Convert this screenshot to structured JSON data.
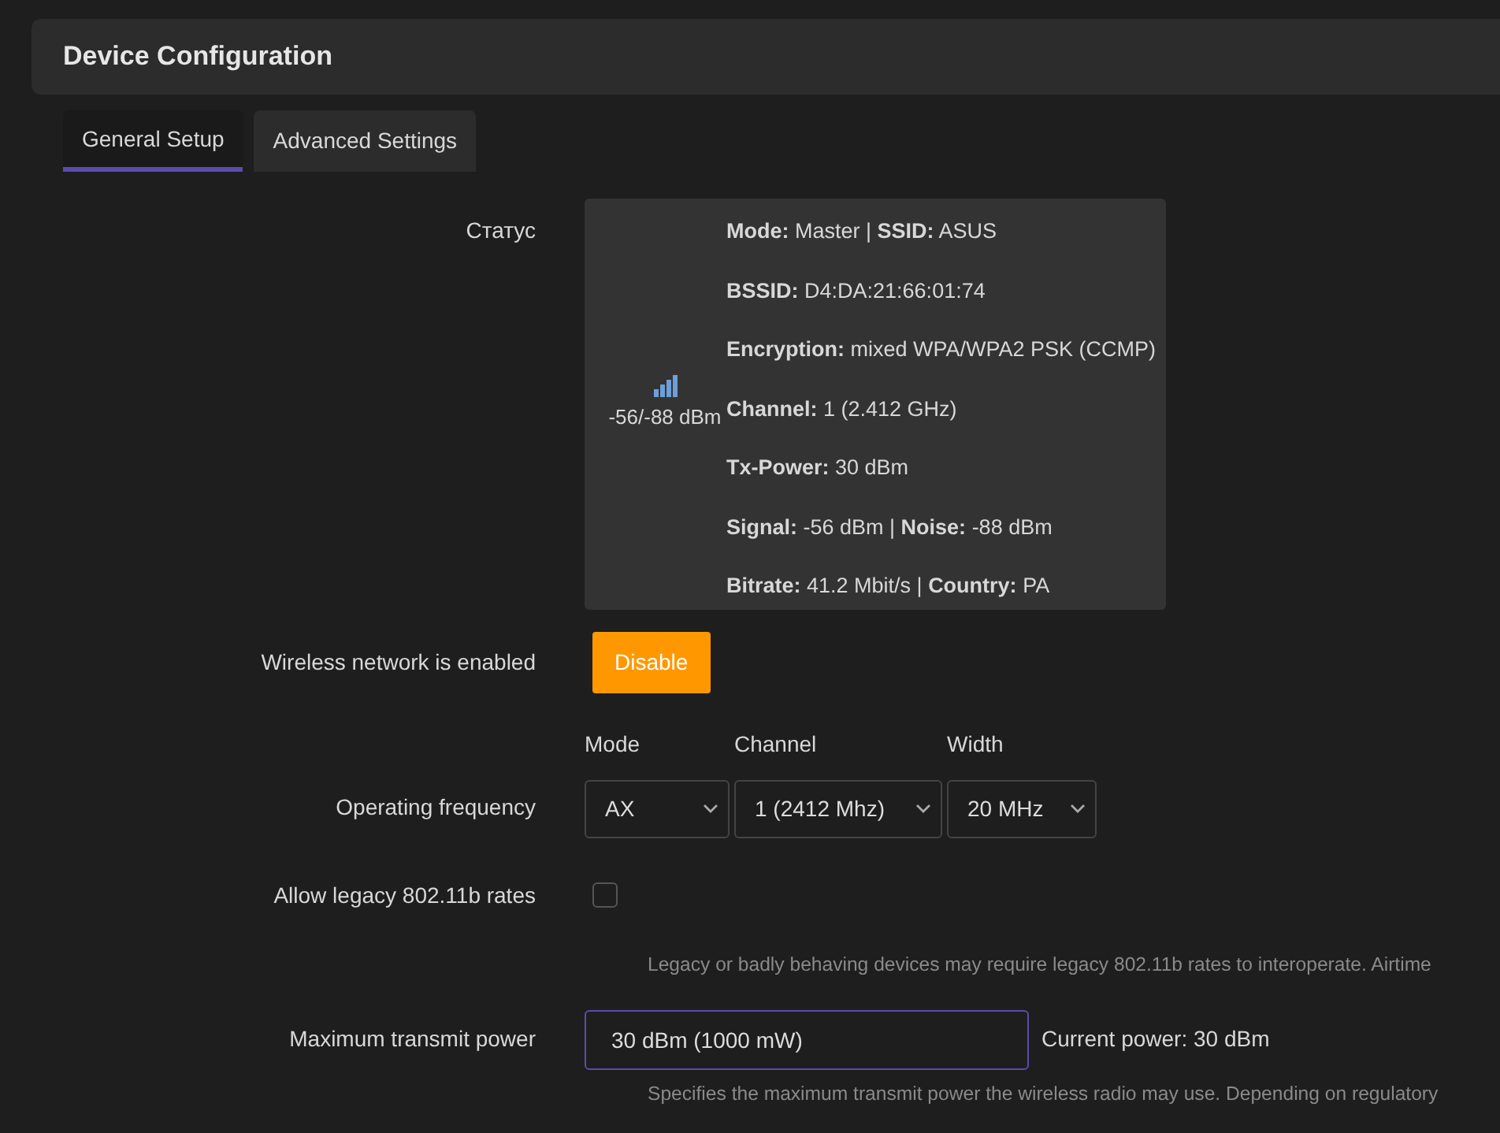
{
  "header": {
    "title": "Device Configuration"
  },
  "tabs": [
    {
      "label": "General Setup",
      "selected": true
    },
    {
      "label": "Advanced Settings",
      "selected": false
    }
  ],
  "status": {
    "label": "Статус",
    "signal_reading": "-56/-88 dBm",
    "lines": [
      "**Mode:** Master | **SSID:** ASUS",
      "**BSSID:** D4:DA:21:66:01:74",
      "**Encryption:** mixed WPA/WPA2 PSK (CCMP)",
      "**Channel:** 1 (2.412 GHz)",
      "**Tx-Power:** 30 dBm",
      "**Signal:** -56 dBm | **Noise:** -88 dBm",
      "**Bitrate:** 41.2 Mbit/s | **Country:** PA"
    ]
  },
  "wireless": {
    "label": "Wireless network is enabled",
    "button": "Disable"
  },
  "frequency": {
    "label": "Operating frequency",
    "selects": [
      {
        "heading": "Mode",
        "value": "AX"
      },
      {
        "heading": "Channel",
        "value": "1 (2412 Mhz)"
      },
      {
        "heading": "Width",
        "value": "20 MHz"
      }
    ]
  },
  "legacy": {
    "label": "Allow legacy 802.11b rates",
    "checked": false,
    "help": "Legacy or badly behaving devices may require legacy 802.11b rates to interoperate. Airtime"
  },
  "txpower": {
    "label": "Maximum transmit power",
    "value": "30 dBm (1000 mW)",
    "current": "Current power: 30 dBm",
    "help": "Specifies the maximum transmit power the wireless radio may use. Depending on regulatory"
  }
}
